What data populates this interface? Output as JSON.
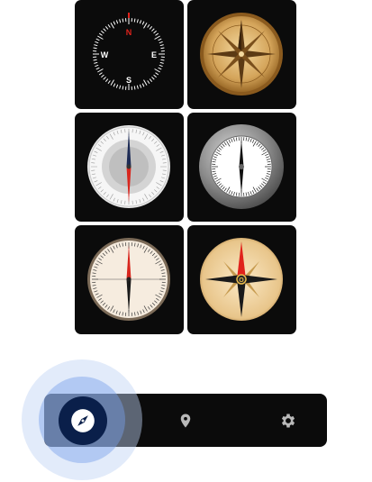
{
  "compass_grid": {
    "styles": [
      {
        "id": "dial-black-digital",
        "north": "N",
        "south": "S",
        "east": "E",
        "west": "W"
      },
      {
        "id": "dial-gold-rose"
      },
      {
        "id": "dial-silver-light"
      },
      {
        "id": "dial-chrome-ring"
      },
      {
        "id": "dial-cream-classic"
      },
      {
        "id": "dial-parchment-rose",
        "center": "O"
      }
    ]
  },
  "bottom_nav": {
    "items": [
      {
        "id": "compass",
        "icon": "compass-icon",
        "active": true
      },
      {
        "id": "map",
        "icon": "location-pin-icon",
        "active": false
      },
      {
        "id": "settings",
        "icon": "gear-icon",
        "active": false
      }
    ]
  },
  "colors": {
    "tile_bg": "#0b0b0b",
    "nav_active_bg": "#0a1f4a",
    "ripple": "#9fbdf0",
    "needle_red": "#e0231c",
    "icon_grey": "#b9b9b9"
  }
}
